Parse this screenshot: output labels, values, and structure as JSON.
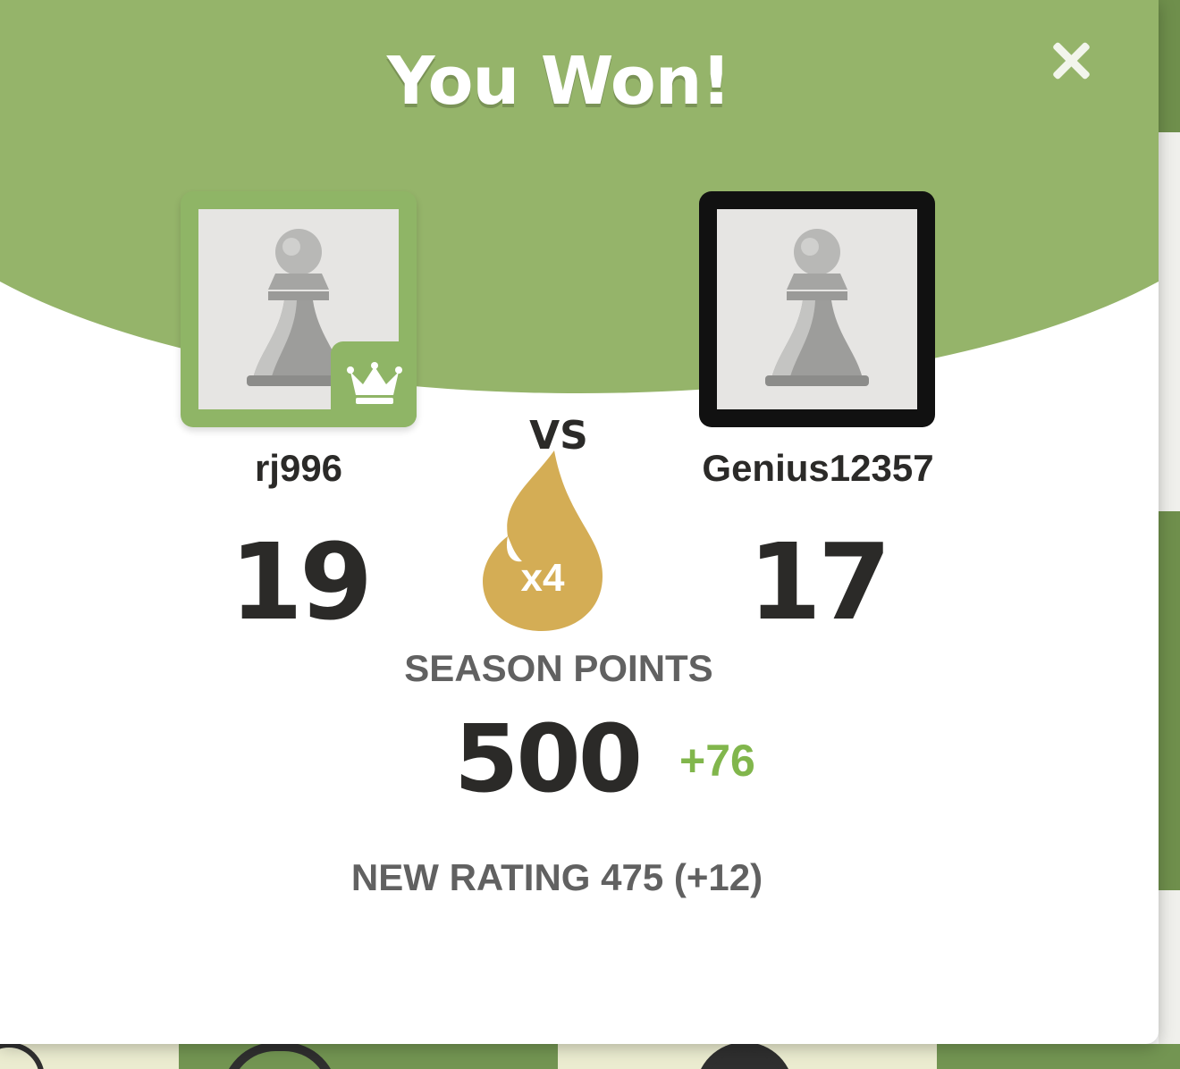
{
  "modal": {
    "title": "You Won!",
    "close_icon": "close-icon",
    "vs_label": "VS",
    "streak_multiplier": "x4",
    "season_label": "SEASON POINTS",
    "season_points": "500",
    "season_points_delta": "+76",
    "rating_text": "NEW RATING 475 (+12)"
  },
  "players": {
    "left": {
      "name": "rj996",
      "score": "19",
      "avatar_icon": "pawn-icon",
      "badge_icon": "crown-icon"
    },
    "right": {
      "name": "Genius12357",
      "score": "17",
      "avatar_icon": "pawn-icon"
    }
  },
  "colors": {
    "header_green": "#95b46a",
    "winner_border": "#8fb566",
    "loser_border": "#111111",
    "flame": "#d4ad55",
    "delta_green": "#81b64c",
    "text_dark": "#2b2a28",
    "text_gray": "#616161"
  }
}
